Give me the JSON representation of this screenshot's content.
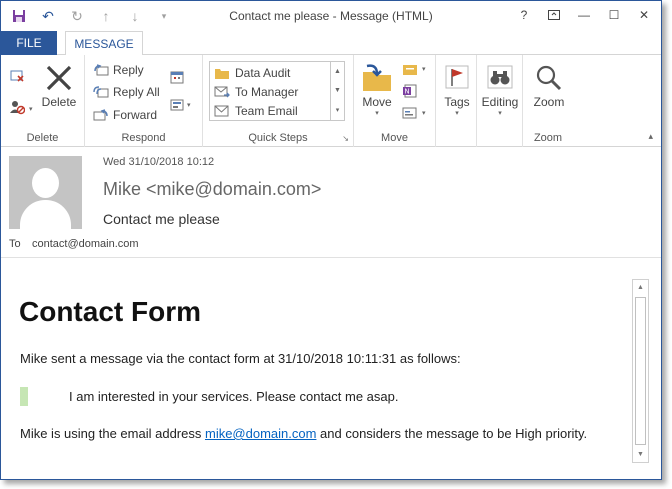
{
  "window": {
    "title": "Contact me please - Message (HTML)",
    "accent_color": "#2b579a"
  },
  "qat": {
    "icons": [
      "save-icon",
      "undo-icon",
      "redo-icon",
      "up-icon",
      "down-icon"
    ]
  },
  "window_controls": {
    "help": "?",
    "restore": "⧉",
    "minimize": "—",
    "maximize": "☐",
    "close": "✕"
  },
  "tabs": {
    "file": "FILE",
    "message": "MESSAGE"
  },
  "ribbon": {
    "delete_group": {
      "label": "Delete",
      "delete_button": "Delete"
    },
    "respond_group": {
      "label": "Respond",
      "reply": "Reply",
      "reply_all": "Reply All",
      "forward": "Forward"
    },
    "quick_steps_group": {
      "label": "Quick Steps",
      "items": [
        "Data Audit",
        "To Manager",
        "Team Email"
      ]
    },
    "move_group": {
      "label": "Move",
      "move_button": "Move"
    },
    "tags_group": {
      "tags_button": "Tags"
    },
    "editing_group": {
      "editing_button": "Editing"
    },
    "zoom_group": {
      "label": "Zoom",
      "zoom_button": "Zoom"
    }
  },
  "header": {
    "date": "Wed 31/10/2018 10:12",
    "from": "Mike <mike@domain.com>",
    "subject": "Contact me please",
    "to_label": "To",
    "to_value": "contact@domain.com"
  },
  "body": {
    "title": "Contact Form",
    "intro": "Mike sent a message via the contact form at 31/10/2018 10:11:31 as follows:",
    "quote": "I am interested in your services. Please contact me asap.",
    "p2_before": "Mike is using the email address ",
    "p2_link": "mike@domain.com",
    "p2_after": " and considers the message to be High priority."
  }
}
